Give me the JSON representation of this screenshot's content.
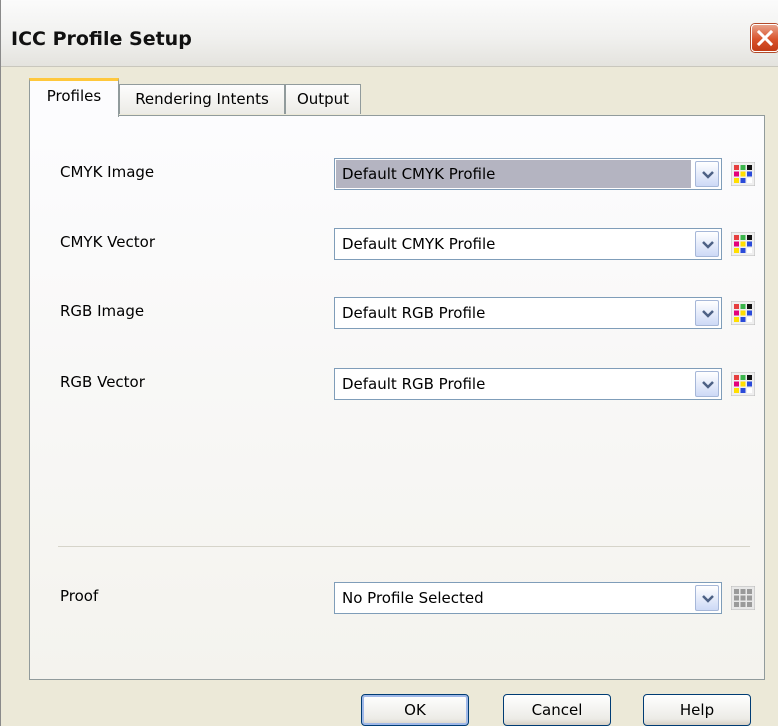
{
  "window": {
    "title": "ICC Profile Setup"
  },
  "tabs": [
    {
      "label": "Profiles",
      "active": true
    },
    {
      "label": "Rendering Intents",
      "active": false
    },
    {
      "label": "Output",
      "active": false
    }
  ],
  "rows": [
    {
      "label": "CMYK Image",
      "value": "Default CMYK Profile"
    },
    {
      "label": "CMYK Vector",
      "value": "Default CMYK Profile"
    },
    {
      "label": "RGB Image",
      "value": "Default RGB Profile"
    },
    {
      "label": "RGB Vector",
      "value": "Default RGB Profile"
    }
  ],
  "proof": {
    "label": "Proof",
    "value": "No Profile Selected"
  },
  "buttons": {
    "ok": "OK",
    "cancel": "Cancel",
    "help": "Help"
  }
}
